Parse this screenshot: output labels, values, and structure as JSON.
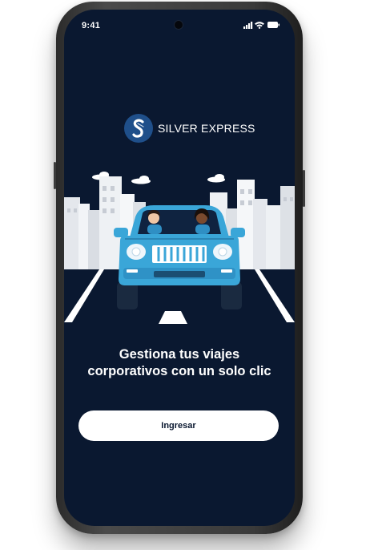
{
  "status_bar": {
    "time": "9:41",
    "icons": [
      "signal-icon",
      "wifi-icon",
      "battery-icon"
    ]
  },
  "brand": {
    "name": "SILVER EXPRESS",
    "logo_icon": "silver-express-logo-icon",
    "accent_color": "#1f4f8a"
  },
  "hero": {
    "illustration": "blue-suv-city-illustration"
  },
  "headline": {
    "line1": "Gestiona tus viajes",
    "line2": "corporativos con un solo clic"
  },
  "cta": {
    "label": "Ingresar"
  },
  "colors": {
    "background": "#0a1830",
    "car_body": "#3aa6d8",
    "button": "#ffffff"
  }
}
